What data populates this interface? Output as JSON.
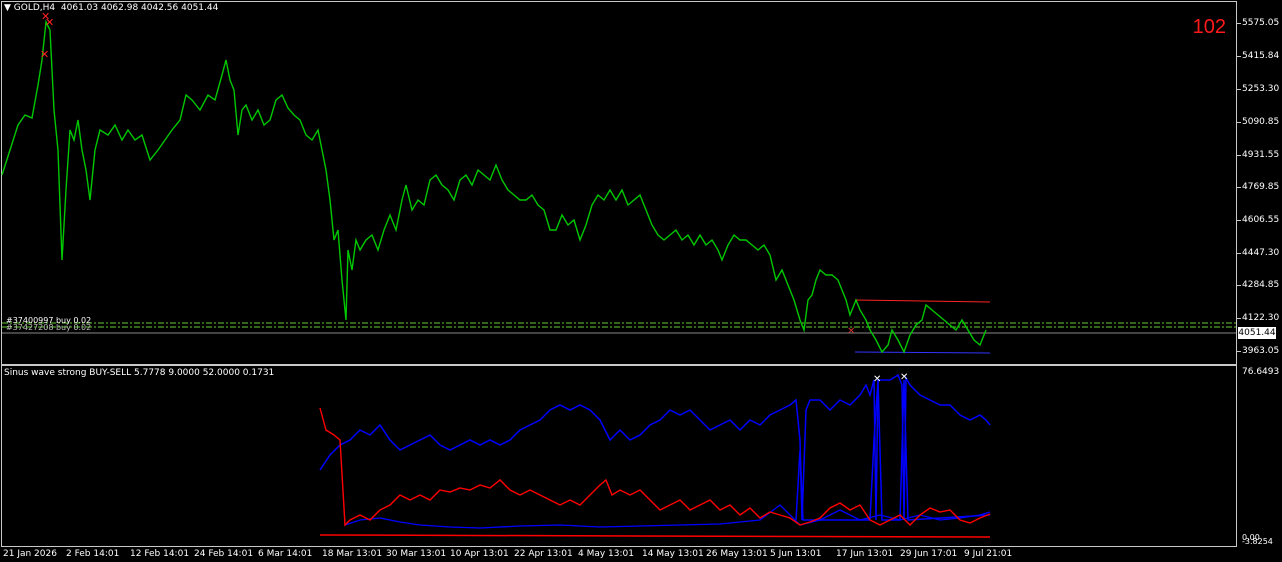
{
  "header": {
    "symbol_menu": "▼",
    "symbol": "GOLD,H4",
    "ohlc": "4061.03 4062.98 4042.56 4051.44"
  },
  "counter": "102",
  "price_axis": [
    "5575.05",
    "5415.84",
    "5253.30",
    "5090.85",
    "4931.55",
    "4769.85",
    "4606.55",
    "4447.30",
    "4284.85",
    "4122.30",
    "3963.05"
  ],
  "current_price": "4051.44",
  "order_labels": {
    "label_a": "#37400997 buy 0.02",
    "label_b": "#37427208 buy 0.02"
  },
  "indicator": {
    "title": "Sinus wave strong BUY-SELL 5.7778 9.0000 52.0000 0.1731",
    "axis_top": "76.6493",
    "axis_bottom": "0.00",
    "axis_bottom2": "-3.8254"
  },
  "time_axis": [
    "21 Jan 2026",
    "2 Feb 14:01",
    "12 Feb 14:01",
    "24 Feb 14:01",
    "6 Mar 14:01",
    "18 Mar 13:01",
    "30 Mar 13:01",
    "10 Apr 13:01",
    "22 Apr 13:01",
    "4 May 13:01",
    "14 May 13:01",
    "26 May 13:01",
    "5 Jun 13:01",
    "17 Jun 13:01",
    "29 Jun 17:01",
    "9 Jul 21:01"
  ],
  "colors": {
    "bars": "#00c800",
    "blue_line": "#0000ff",
    "red_line": "#ff0000",
    "dashed_line": "#66cc33"
  }
}
